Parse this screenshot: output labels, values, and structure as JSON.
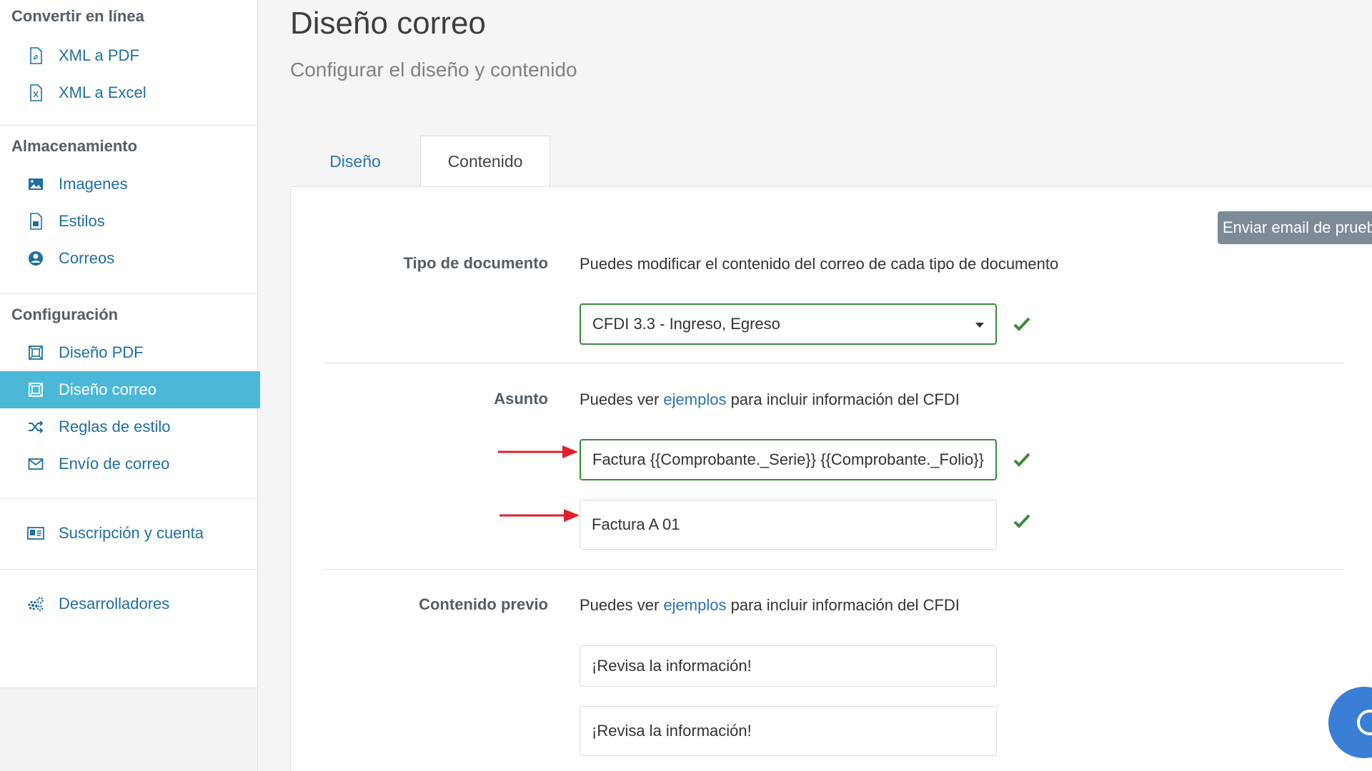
{
  "sidebar": {
    "sections": [
      {
        "title": "Convertir en línea",
        "items": [
          {
            "label": "XML a PDF",
            "icon": "pdf-file-icon"
          },
          {
            "label": "XML a Excel",
            "icon": "excel-file-icon"
          }
        ]
      },
      {
        "title": "Almacenamiento",
        "items": [
          {
            "label": "Imagenes",
            "icon": "image-icon"
          },
          {
            "label": "Estilos",
            "icon": "style-file-icon"
          },
          {
            "label": "Correos",
            "icon": "user-circle-icon"
          }
        ]
      },
      {
        "title": "Configuración",
        "items": [
          {
            "label": "Diseño PDF",
            "icon": "layout-icon"
          },
          {
            "label": "Diseño correo",
            "icon": "layout-icon",
            "active": true
          },
          {
            "label": "Reglas de estilo",
            "icon": "shuffle-icon"
          },
          {
            "label": "Envío de correo",
            "icon": "envelope-icon"
          }
        ]
      },
      {
        "items": [
          {
            "label": "Suscripción y cuenta",
            "icon": "id-card-icon"
          }
        ]
      },
      {
        "items": [
          {
            "label": "Desarrolladores",
            "icon": "gears-icon"
          }
        ]
      }
    ]
  },
  "header": {
    "title": "Diseño correo",
    "subtitle": "Configurar el diseño y contenido"
  },
  "tabs": [
    {
      "label": "Diseño",
      "active": false
    },
    {
      "label": "Contenido",
      "active": true
    }
  ],
  "panel": {
    "test_button": "Enviar email de prueba",
    "tipo": {
      "label": "Tipo de documento",
      "help": "Puedes modificar el contenido del correo de cada tipo de documento",
      "selected": "CFDI 3.3 - Ingreso, Egreso"
    },
    "asunto": {
      "label": "Asunto",
      "help_prefix": "Puedes ver ",
      "help_link": "ejemplos",
      "help_suffix": " para incluir información del CFDI",
      "template_value": "Factura {{Comprobante._Serie}} {{Comprobante._Folio}}",
      "preview_value": "Factura A 01"
    },
    "contenido_previo": {
      "label": "Contenido previo",
      "help_prefix": "Puedes ver ",
      "help_link": "ejemplos",
      "help_suffix": " para incluir información del CFDI",
      "template_value": "¡Revisa la información!",
      "preview_value": "¡Revisa la información!"
    }
  },
  "colors": {
    "active_nav": "#4bb8d8",
    "link": "#2a73b0",
    "valid_border": "#3c8a3c",
    "check": "#3c8a3c",
    "arrow": "#e0202a",
    "test_button": "#7d8a98"
  }
}
